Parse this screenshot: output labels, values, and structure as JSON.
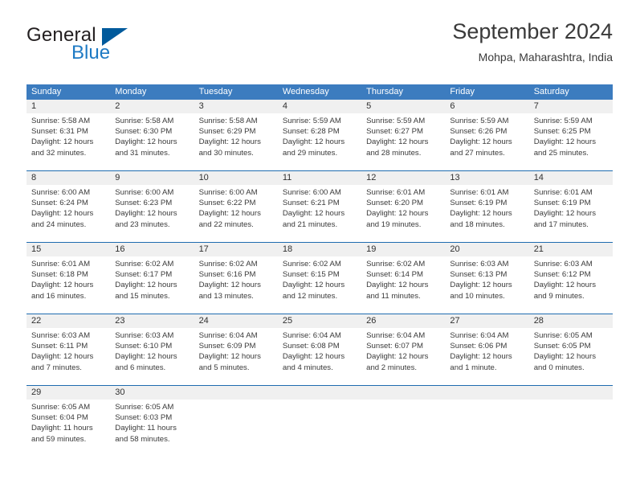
{
  "brand": {
    "word1": "General",
    "word2": "Blue",
    "triangle_icon": "triangle-logo-icon",
    "colors": {
      "word1": "#231f20",
      "word2": "#1e7ac4",
      "triangle": "#005a9c"
    }
  },
  "header": {
    "title": "September 2024",
    "subtitle": "Mohpa, Maharashtra, India"
  },
  "theme": {
    "header_blue": "#3c7cbf",
    "separator_blue": "#1f6cb0",
    "daynum_band": "#f0f0f0"
  },
  "calendar": {
    "weekdays": [
      "Sunday",
      "Monday",
      "Tuesday",
      "Wednesday",
      "Thursday",
      "Friday",
      "Saturday"
    ],
    "weeks": [
      [
        {
          "day": "1",
          "sunrise": "Sunrise: 5:58 AM",
          "sunset": "Sunset: 6:31 PM",
          "daylight_1": "Daylight: 12 hours",
          "daylight_2": "and 32 minutes."
        },
        {
          "day": "2",
          "sunrise": "Sunrise: 5:58 AM",
          "sunset": "Sunset: 6:30 PM",
          "daylight_1": "Daylight: 12 hours",
          "daylight_2": "and 31 minutes."
        },
        {
          "day": "3",
          "sunrise": "Sunrise: 5:58 AM",
          "sunset": "Sunset: 6:29 PM",
          "daylight_1": "Daylight: 12 hours",
          "daylight_2": "and 30 minutes."
        },
        {
          "day": "4",
          "sunrise": "Sunrise: 5:59 AM",
          "sunset": "Sunset: 6:28 PM",
          "daylight_1": "Daylight: 12 hours",
          "daylight_2": "and 29 minutes."
        },
        {
          "day": "5",
          "sunrise": "Sunrise: 5:59 AM",
          "sunset": "Sunset: 6:27 PM",
          "daylight_1": "Daylight: 12 hours",
          "daylight_2": "and 28 minutes."
        },
        {
          "day": "6",
          "sunrise": "Sunrise: 5:59 AM",
          "sunset": "Sunset: 6:26 PM",
          "daylight_1": "Daylight: 12 hours",
          "daylight_2": "and 27 minutes."
        },
        {
          "day": "7",
          "sunrise": "Sunrise: 5:59 AM",
          "sunset": "Sunset: 6:25 PM",
          "daylight_1": "Daylight: 12 hours",
          "daylight_2": "and 25 minutes."
        }
      ],
      [
        {
          "day": "8",
          "sunrise": "Sunrise: 6:00 AM",
          "sunset": "Sunset: 6:24 PM",
          "daylight_1": "Daylight: 12 hours",
          "daylight_2": "and 24 minutes."
        },
        {
          "day": "9",
          "sunrise": "Sunrise: 6:00 AM",
          "sunset": "Sunset: 6:23 PM",
          "daylight_1": "Daylight: 12 hours",
          "daylight_2": "and 23 minutes."
        },
        {
          "day": "10",
          "sunrise": "Sunrise: 6:00 AM",
          "sunset": "Sunset: 6:22 PM",
          "daylight_1": "Daylight: 12 hours",
          "daylight_2": "and 22 minutes."
        },
        {
          "day": "11",
          "sunrise": "Sunrise: 6:00 AM",
          "sunset": "Sunset: 6:21 PM",
          "daylight_1": "Daylight: 12 hours",
          "daylight_2": "and 21 minutes."
        },
        {
          "day": "12",
          "sunrise": "Sunrise: 6:01 AM",
          "sunset": "Sunset: 6:20 PM",
          "daylight_1": "Daylight: 12 hours",
          "daylight_2": "and 19 minutes."
        },
        {
          "day": "13",
          "sunrise": "Sunrise: 6:01 AM",
          "sunset": "Sunset: 6:19 PM",
          "daylight_1": "Daylight: 12 hours",
          "daylight_2": "and 18 minutes."
        },
        {
          "day": "14",
          "sunrise": "Sunrise: 6:01 AM",
          "sunset": "Sunset: 6:19 PM",
          "daylight_1": "Daylight: 12 hours",
          "daylight_2": "and 17 minutes."
        }
      ],
      [
        {
          "day": "15",
          "sunrise": "Sunrise: 6:01 AM",
          "sunset": "Sunset: 6:18 PM",
          "daylight_1": "Daylight: 12 hours",
          "daylight_2": "and 16 minutes."
        },
        {
          "day": "16",
          "sunrise": "Sunrise: 6:02 AM",
          "sunset": "Sunset: 6:17 PM",
          "daylight_1": "Daylight: 12 hours",
          "daylight_2": "and 15 minutes."
        },
        {
          "day": "17",
          "sunrise": "Sunrise: 6:02 AM",
          "sunset": "Sunset: 6:16 PM",
          "daylight_1": "Daylight: 12 hours",
          "daylight_2": "and 13 minutes."
        },
        {
          "day": "18",
          "sunrise": "Sunrise: 6:02 AM",
          "sunset": "Sunset: 6:15 PM",
          "daylight_1": "Daylight: 12 hours",
          "daylight_2": "and 12 minutes."
        },
        {
          "day": "19",
          "sunrise": "Sunrise: 6:02 AM",
          "sunset": "Sunset: 6:14 PM",
          "daylight_1": "Daylight: 12 hours",
          "daylight_2": "and 11 minutes."
        },
        {
          "day": "20",
          "sunrise": "Sunrise: 6:03 AM",
          "sunset": "Sunset: 6:13 PM",
          "daylight_1": "Daylight: 12 hours",
          "daylight_2": "and 10 minutes."
        },
        {
          "day": "21",
          "sunrise": "Sunrise: 6:03 AM",
          "sunset": "Sunset: 6:12 PM",
          "daylight_1": "Daylight: 12 hours",
          "daylight_2": "and 9 minutes."
        }
      ],
      [
        {
          "day": "22",
          "sunrise": "Sunrise: 6:03 AM",
          "sunset": "Sunset: 6:11 PM",
          "daylight_1": "Daylight: 12 hours",
          "daylight_2": "and 7 minutes."
        },
        {
          "day": "23",
          "sunrise": "Sunrise: 6:03 AM",
          "sunset": "Sunset: 6:10 PM",
          "daylight_1": "Daylight: 12 hours",
          "daylight_2": "and 6 minutes."
        },
        {
          "day": "24",
          "sunrise": "Sunrise: 6:04 AM",
          "sunset": "Sunset: 6:09 PM",
          "daylight_1": "Daylight: 12 hours",
          "daylight_2": "and 5 minutes."
        },
        {
          "day": "25",
          "sunrise": "Sunrise: 6:04 AM",
          "sunset": "Sunset: 6:08 PM",
          "daylight_1": "Daylight: 12 hours",
          "daylight_2": "and 4 minutes."
        },
        {
          "day": "26",
          "sunrise": "Sunrise: 6:04 AM",
          "sunset": "Sunset: 6:07 PM",
          "daylight_1": "Daylight: 12 hours",
          "daylight_2": "and 2 minutes."
        },
        {
          "day": "27",
          "sunrise": "Sunrise: 6:04 AM",
          "sunset": "Sunset: 6:06 PM",
          "daylight_1": "Daylight: 12 hours",
          "daylight_2": "and 1 minute."
        },
        {
          "day": "28",
          "sunrise": "Sunrise: 6:05 AM",
          "sunset": "Sunset: 6:05 PM",
          "daylight_1": "Daylight: 12 hours",
          "daylight_2": "and 0 minutes."
        }
      ],
      [
        {
          "day": "29",
          "sunrise": "Sunrise: 6:05 AM",
          "sunset": "Sunset: 6:04 PM",
          "daylight_1": "Daylight: 11 hours",
          "daylight_2": "and 59 minutes."
        },
        {
          "day": "30",
          "sunrise": "Sunrise: 6:05 AM",
          "sunset": "Sunset: 6:03 PM",
          "daylight_1": "Daylight: 11 hours",
          "daylight_2": "and 58 minutes."
        },
        {
          "day": "",
          "sunrise": "",
          "sunset": "",
          "daylight_1": "",
          "daylight_2": ""
        },
        {
          "day": "",
          "sunrise": "",
          "sunset": "",
          "daylight_1": "",
          "daylight_2": ""
        },
        {
          "day": "",
          "sunrise": "",
          "sunset": "",
          "daylight_1": "",
          "daylight_2": ""
        },
        {
          "day": "",
          "sunrise": "",
          "sunset": "",
          "daylight_1": "",
          "daylight_2": ""
        },
        {
          "day": "",
          "sunrise": "",
          "sunset": "",
          "daylight_1": "",
          "daylight_2": ""
        }
      ]
    ]
  }
}
